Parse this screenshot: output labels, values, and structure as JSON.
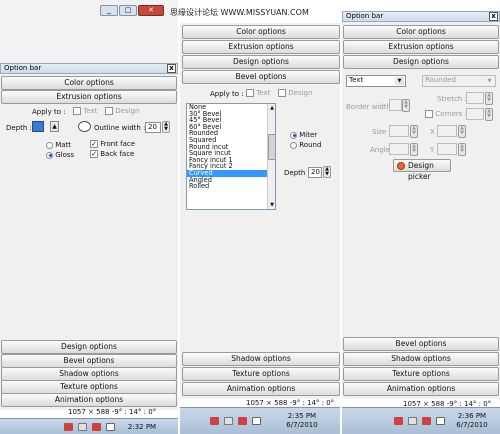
{
  "watermark": "思缘设计论坛 WWW.MISSYUAN.COM",
  "left": {
    "title": "Option bar",
    "close": "x",
    "top_buttons": [
      "Color options",
      "Extrusion options"
    ],
    "apply_to": "Apply to :",
    "text": "Text",
    "design": "Design",
    "depth": "Depth :",
    "outline_width": "Outline width :",
    "outline_value": "20",
    "matt": "Matt",
    "gloss": "Gloss",
    "front_face": "Front face",
    "back_face": "Back face",
    "bottom_buttons": [
      "Design options",
      "Bevel options",
      "Shadow options",
      "Texture options",
      "Animation options"
    ],
    "status": "1057 × 588  -9° : 14° : 0°",
    "clock": "2:32 PM"
  },
  "mid": {
    "top_buttons": [
      "Color options",
      "Extrusion options",
      "Design options",
      "Bevel options"
    ],
    "bevel_list": [
      "None",
      "30° Bevel",
      "45° Bevel",
      "60° Bevel",
      "Rounded",
      "Squared",
      "Round incut",
      "Square incut",
      "Fancy incut 1",
      "Fancy incut 2",
      "Curved",
      "Angled",
      "Rolled"
    ],
    "selected_index": 10,
    "apply_to": "Apply to :",
    "text": "Text",
    "design": "Design",
    "miter": "Miter",
    "round": "Round",
    "depth": "Depth :",
    "depth_value": "20",
    "bottom_buttons": [
      "Shadow options",
      "Texture options",
      "Animation options"
    ],
    "status": "1057 × 588  -9° : 14° : 0°",
    "clock": "2:35 PM",
    "date": "6/7/2010"
  },
  "right": {
    "title": "Option bar",
    "close": "x",
    "top_buttons": [
      "Color options",
      "Extrusion options",
      "Design options"
    ],
    "text_select": "Text",
    "rounded_select": "Rounded",
    "border_width": "Border width :",
    "stretch": "Stretch :",
    "corners": "Corners :",
    "size": "Size",
    "x": "X",
    "angle": "Angle",
    "y": "Y",
    "design_picker": "Design picker",
    "bottom_buttons": [
      "Bevel options",
      "Shadow options",
      "Texture options",
      "Animation options"
    ],
    "status": "1057 × 588  -9° : 14° : 0°",
    "clock": "2:36 PM",
    "date": "6/7/2010"
  },
  "colors": {
    "selection": "#3399ff",
    "taskbar": "#b5c9dd"
  }
}
